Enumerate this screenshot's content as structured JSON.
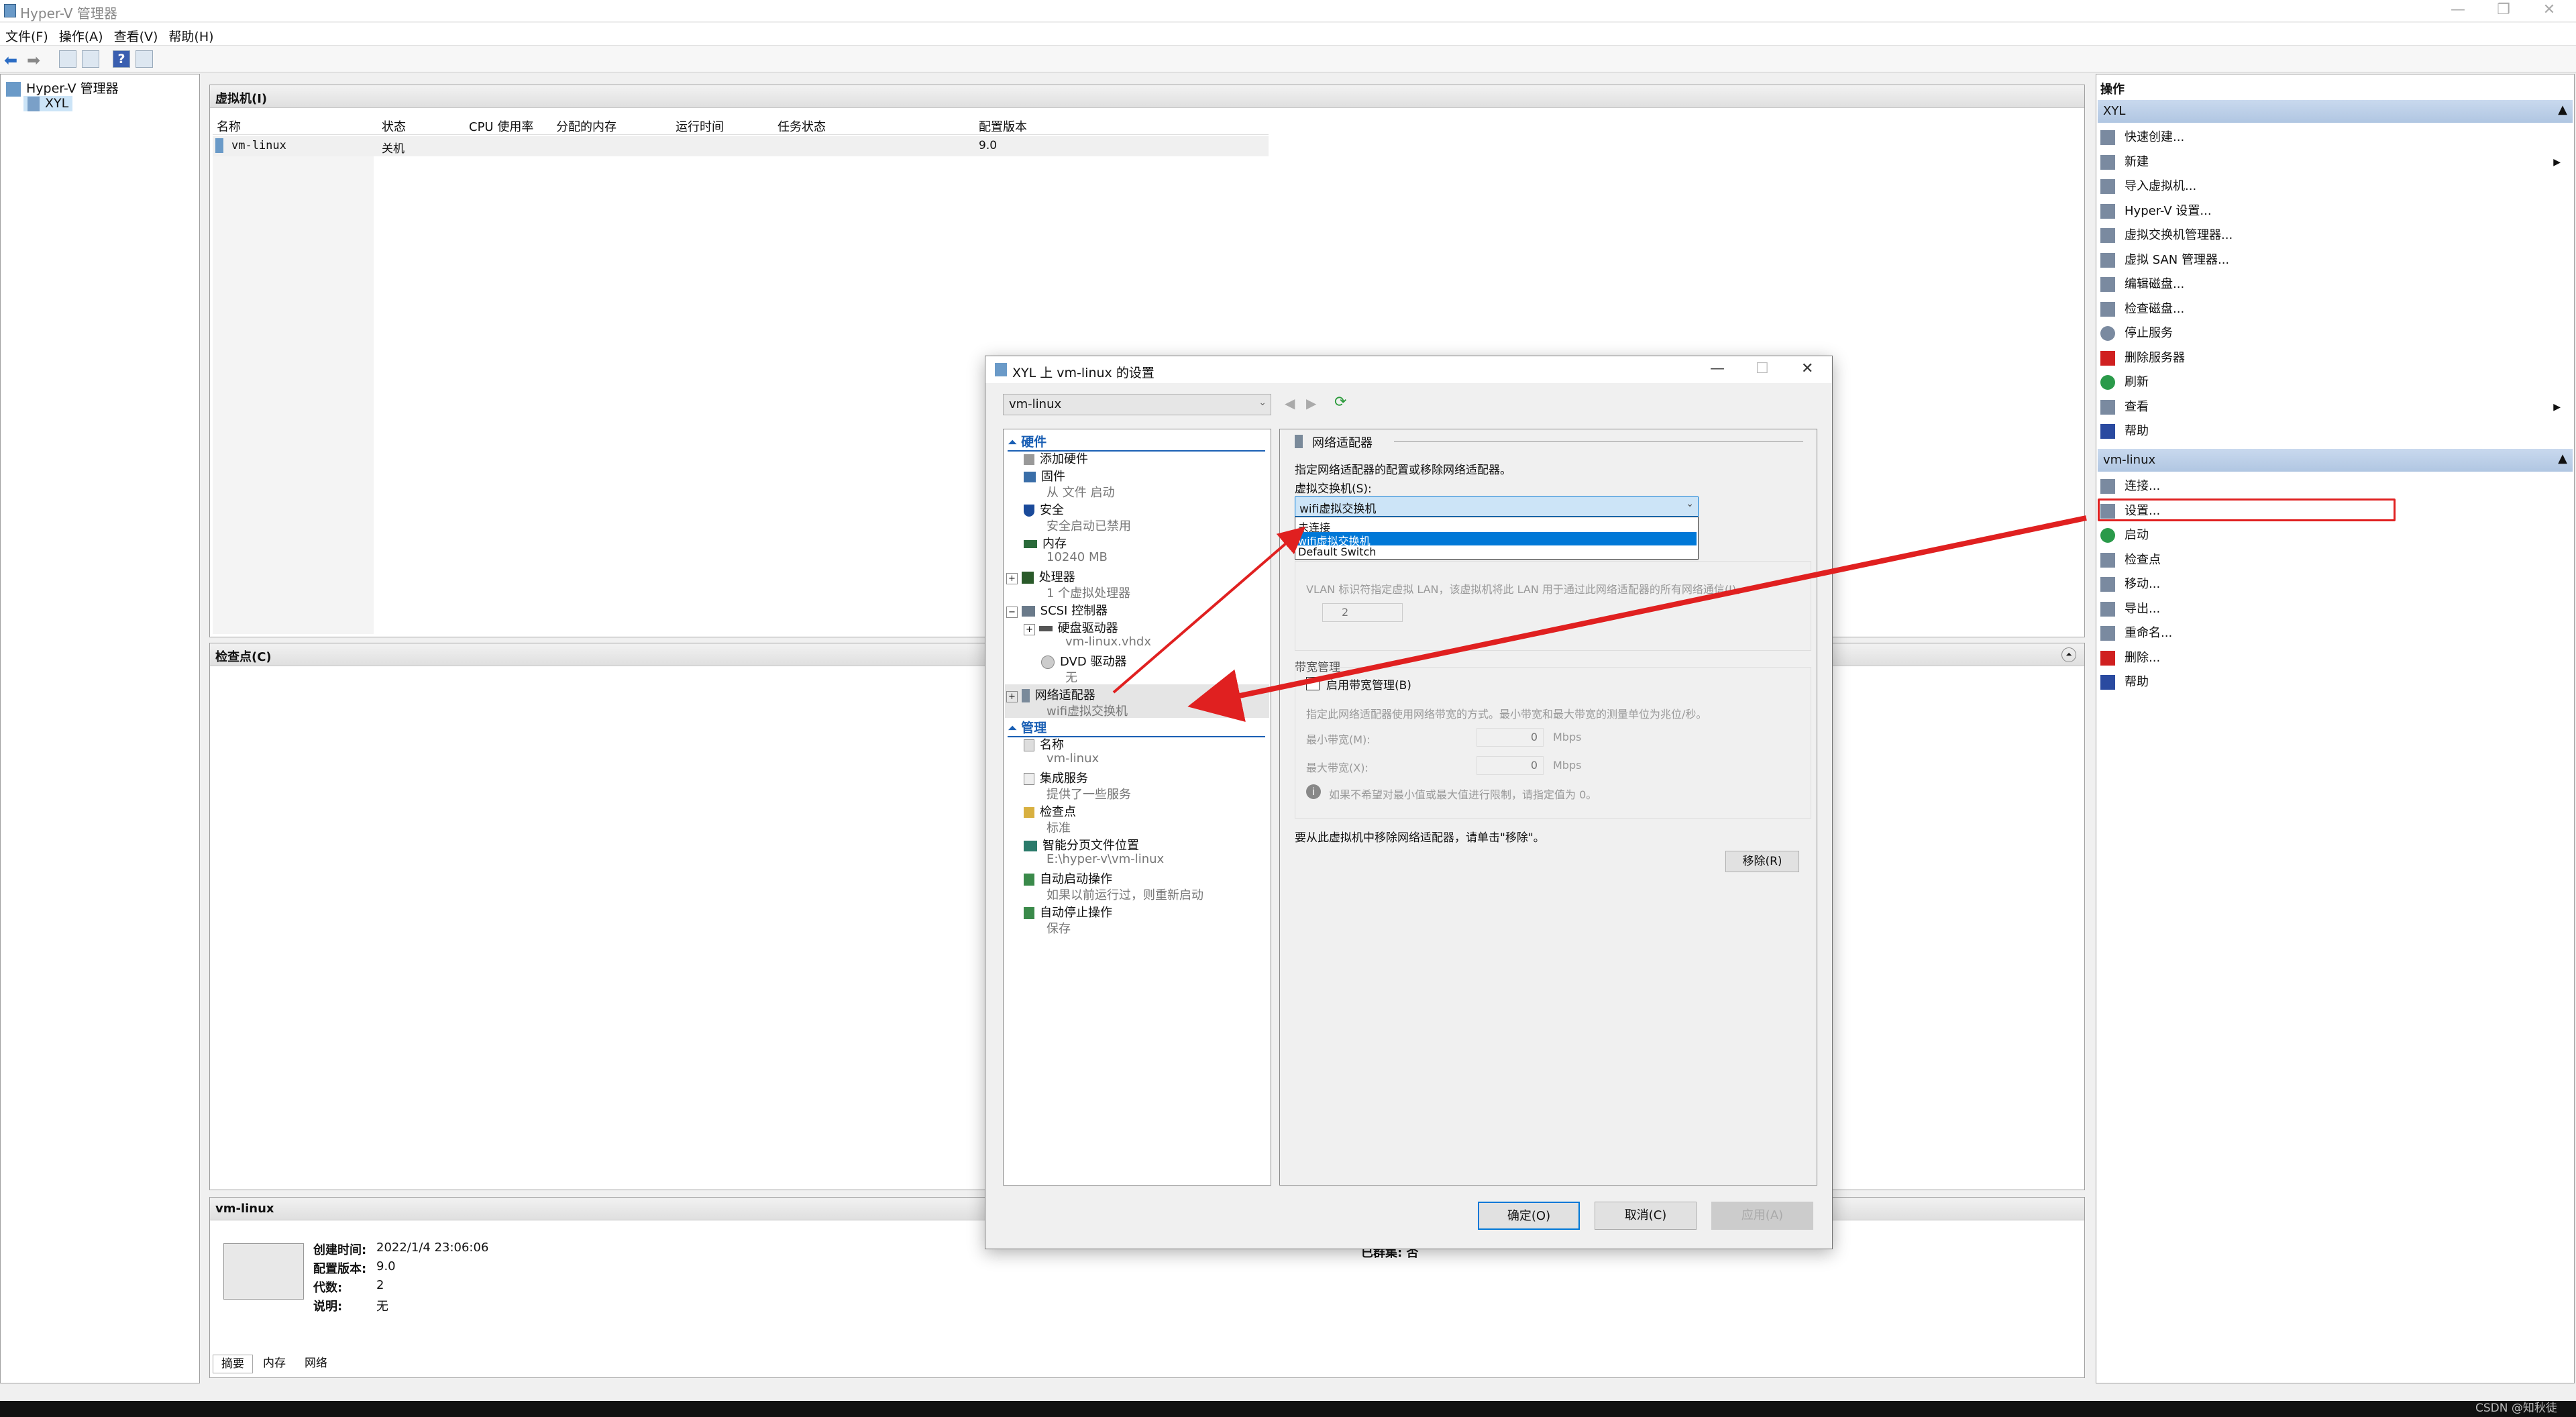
{
  "window": {
    "title": "Hyper-V 管理器",
    "min": "—",
    "max": "❐",
    "close": "✕"
  },
  "menu": [
    "文件(F)",
    "操作(A)",
    "查看(V)",
    "帮助(H)"
  ],
  "tree": {
    "root": "Hyper-V 管理器",
    "host": "XYL"
  },
  "vms": {
    "title": "虚拟机(I)",
    "headers": [
      "名称",
      "状态",
      "CPU 使用率",
      "分配的内存",
      "运行时间",
      "任务状态",
      "配置版本"
    ],
    "rows": [
      {
        "name": "vm-linux",
        "state": "关机",
        "version": "9.0"
      }
    ]
  },
  "checkpoints": {
    "title": "检查点(C)"
  },
  "details": {
    "title": "vm-linux",
    "created_label": "创建时间:",
    "created": "2022/1/4 23:06:06",
    "config_label": "配置版本:",
    "config": "9.0",
    "gen_label": "代数:",
    "gen": "2",
    "note_label": "说明:",
    "note": "无",
    "clustered": "已群集: 否",
    "tabs": [
      "摘要",
      "内存",
      "网络"
    ]
  },
  "actions": {
    "title": "操作",
    "host_section": "XYL",
    "host_items": [
      {
        "label": "快速创建...",
        "icon": "quick-create-icon"
      },
      {
        "label": "新建",
        "icon": "new-icon",
        "arrow": "▶"
      },
      {
        "label": "导入虚拟机...",
        "icon": "import-icon"
      },
      {
        "label": "Hyper-V 设置...",
        "icon": "hyperv-settings-icon"
      },
      {
        "label": "虚拟交换机管理器...",
        "icon": "switch-manager-icon"
      },
      {
        "label": "虚拟 SAN 管理器...",
        "icon": "san-manager-icon"
      },
      {
        "label": "编辑磁盘...",
        "icon": "edit-disk-icon"
      },
      {
        "label": "检查磁盘...",
        "icon": "inspect-disk-icon"
      },
      {
        "label": "停止服务",
        "icon": "stop-service-icon"
      },
      {
        "label": "删除服务器",
        "icon": "remove-server-icon"
      },
      {
        "label": "刷新",
        "icon": "refresh-icon"
      },
      {
        "label": "查看",
        "icon": "view-icon",
        "arrow": "▶"
      },
      {
        "label": "帮助",
        "icon": "help-icon"
      }
    ],
    "vm_section": "vm-linux",
    "vm_items": [
      {
        "label": "连接...",
        "icon": "connect-icon"
      },
      {
        "label": "设置...",
        "icon": "settings-icon"
      },
      {
        "label": "启动",
        "icon": "start-icon"
      },
      {
        "label": "检查点",
        "icon": "checkpoint-icon"
      },
      {
        "label": "移动...",
        "icon": "move-icon"
      },
      {
        "label": "导出...",
        "icon": "export-icon"
      },
      {
        "label": "重命名...",
        "icon": "rename-icon"
      },
      {
        "label": "删除...",
        "icon": "delete-icon"
      },
      {
        "label": "帮助",
        "icon": "help-icon"
      }
    ]
  },
  "dialog": {
    "title": "XYL 上 vm-linux 的设置",
    "vm_select": "vm-linux",
    "hardware_label": "硬件",
    "hw": [
      {
        "label": "添加硬件",
        "sub": ""
      },
      {
        "label": "固件",
        "sub": "从 文件 启动"
      },
      {
        "label": "安全",
        "sub": "安全启动已禁用"
      },
      {
        "label": "内存",
        "sub": "10240 MB"
      },
      {
        "label": "处理器",
        "sub": "1 个虚拟处理器"
      },
      {
        "label": "SCSI 控制器",
        "sub": ""
      },
      {
        "label": "硬盘驱动器",
        "sub": "vm-linux.vhdx"
      },
      {
        "label": "DVD 驱动器",
        "sub": "无"
      },
      {
        "label": "网络适配器",
        "sub": "wifi虚拟交换机"
      }
    ],
    "management_label": "管理",
    "mgmt": [
      {
        "label": "名称",
        "sub": "vm-linux"
      },
      {
        "label": "集成服务",
        "sub": "提供了一些服务"
      },
      {
        "label": "检查点",
        "sub": "标准"
      },
      {
        "label": "智能分页文件位置",
        "sub": "E:\\hyper-v\\vm-linux"
      },
      {
        "label": "自动启动操作",
        "sub": "如果以前运行过，则重新启动"
      },
      {
        "label": "自动停止操作",
        "sub": "保存"
      }
    ],
    "right": {
      "section": "网络适配器",
      "desc": "指定网络适配器的配置或移除网络适配器。",
      "switch_label": "虚拟交换机(S):",
      "switch_value": "wifi虚拟交换机",
      "options": [
        "未连接",
        "wifi虚拟交换机",
        "Default Switch"
      ],
      "vlan_text": "VLAN 标识符指定虚拟 LAN，该虚拟机将此 LAN 用于通过此网络适配器的所有网络通信(I)。",
      "vlan_value": "2",
      "bw_title": "带宽管理",
      "bw_enable": "启用带宽管理(B)",
      "bw_desc": "指定此网络适配器使用网络带宽的方式。最小带宽和最大带宽的测量单位为兆位/秒。",
      "min_label": "最小带宽(M):",
      "min_value": "0",
      "max_label": "最大带宽(X):",
      "max_value": "0",
      "unit": "Mbps",
      "bw_note": "如果不希望对最小值或最大值进行限制，请指定值为 0。",
      "remove_text": "要从此虚拟机中移除网络适配器，请单击\"移除\"。",
      "remove_btn": "移除(R)"
    },
    "buttons": {
      "ok": "确定(O)",
      "cancel": "取消(C)",
      "apply": "应用(A)"
    }
  },
  "watermark": "CSDN @知秋徒",
  "colors": {
    "annotation": "#e02020",
    "selection": "#0078d7"
  }
}
